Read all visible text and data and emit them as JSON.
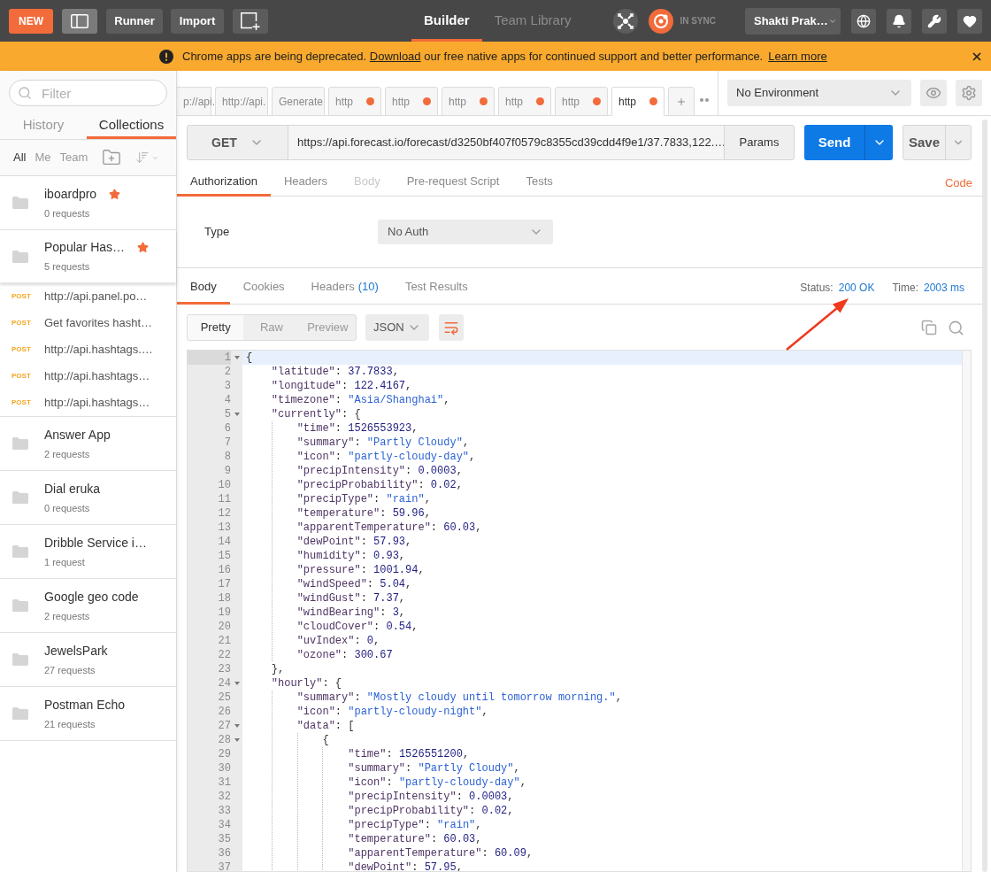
{
  "top_bar": {
    "new_button": "NEW",
    "runner_button": "Runner",
    "import_button": "Import",
    "nav_tabs": [
      {
        "label": "Builder",
        "selected": true
      },
      {
        "label": "Team Library",
        "selected": false
      }
    ],
    "sync_status": "IN SYNC",
    "user_menu": "Shakti Prak…"
  },
  "banner": {
    "message_start": "Chrome apps are being deprecated.",
    "message_link": "Download",
    "message_end": "our free native apps for continued support and better performance.",
    "learn_more_link": "Learn more"
  },
  "sidebar": {
    "filter_placeholder": "Filter",
    "tabs": [
      {
        "label": "History",
        "selected": false
      },
      {
        "label": "Collections",
        "selected": true
      }
    ],
    "owner_filters": [
      {
        "label": "All",
        "selected": true
      },
      {
        "label": "Me",
        "selected": false
      },
      {
        "label": "Team",
        "selected": false
      }
    ],
    "collections": [
      {
        "name": "iboardpro",
        "count": "0 requests",
        "starred": true,
        "expanded": false
      },
      {
        "name": "Popular Has…",
        "count": "5 requests",
        "starred": true,
        "expanded": true,
        "requests": [
          {
            "method": "POST",
            "name": "http://api.panel.po…"
          },
          {
            "method": "POST",
            "name": "Get favorites hasht…"
          },
          {
            "method": "POST",
            "name": "http://api.hashtags.…"
          },
          {
            "method": "POST",
            "name": "http://api.hashtags…"
          },
          {
            "method": "POST",
            "name": "http://api.hashtags…"
          }
        ]
      },
      {
        "name": "Answer App",
        "count": "2 requests",
        "starred": false,
        "expanded": false
      },
      {
        "name": "Dial eruka",
        "count": "0 requests",
        "starred": false,
        "expanded": false
      },
      {
        "name": "Dribble Service i…",
        "count": "1 request",
        "starred": false,
        "expanded": false
      },
      {
        "name": "Google geo code",
        "count": "2 requests",
        "starred": false,
        "expanded": false
      },
      {
        "name": "JewelsPark",
        "count": "27 requests",
        "starred": false,
        "expanded": false
      },
      {
        "name": "Postman Echo",
        "count": "21 requests",
        "starred": false,
        "expanded": false
      }
    ]
  },
  "request_tabs": [
    {
      "label": "p://api.",
      "unsaved": false,
      "selected": false
    },
    {
      "label": "http://api.",
      "unsaved": false,
      "selected": false
    },
    {
      "label": "Generate",
      "unsaved": false,
      "selected": false
    },
    {
      "label": "http",
      "unsaved": true,
      "selected": false
    },
    {
      "label": "http",
      "unsaved": true,
      "selected": false
    },
    {
      "label": "http",
      "unsaved": true,
      "selected": false
    },
    {
      "label": "http",
      "unsaved": true,
      "selected": false
    },
    {
      "label": "http",
      "unsaved": true,
      "selected": false
    },
    {
      "label": "http",
      "unsaved": true,
      "selected": true
    }
  ],
  "environment": "No Environment",
  "request": {
    "method": "GET",
    "url": "https://api.forecast.io/forecast/d3250bf407f0579c8355cd39cdd4f9e1/37.7833,122.…",
    "params_button": "Params",
    "send_button": "Send",
    "save_button": "Save"
  },
  "request_options": {
    "tabs": [
      {
        "label": "Authorization",
        "selected": true,
        "disabled": false
      },
      {
        "label": "Headers",
        "selected": false,
        "disabled": false
      },
      {
        "label": "Body",
        "selected": false,
        "disabled": true
      },
      {
        "label": "Pre-request Script",
        "selected": false,
        "disabled": false
      },
      {
        "label": "Tests",
        "selected": false,
        "disabled": false
      }
    ],
    "code_link": "Code"
  },
  "authorization": {
    "type_label": "Type",
    "type_value": "No Auth"
  },
  "response": {
    "tabs": [
      {
        "label": "Body",
        "selected": true
      },
      {
        "label": "Cookies",
        "selected": false
      },
      {
        "label": "Headers",
        "count": "(10)",
        "selected": false
      },
      {
        "label": "Test Results",
        "selected": false
      }
    ],
    "status_label": "Status:",
    "status_value": "200 OK",
    "time_label": "Time:",
    "time_value": "2003 ms",
    "view_modes": [
      {
        "label": "Pretty",
        "selected": true
      },
      {
        "label": "Raw",
        "selected": false
      },
      {
        "label": "Preview",
        "selected": false
      }
    ],
    "format": "JSON",
    "lines": [
      {
        "number": "1",
        "text": "{",
        "foldable": true,
        "active": true
      },
      {
        "number": "2",
        "text": "    \"latitude\": 37.7833,",
        "foldable": false,
        "active": false
      },
      {
        "number": "3",
        "text": "    \"longitude\": 122.4167,",
        "foldable": false,
        "active": false
      },
      {
        "number": "4",
        "text": "    \"timezone\": \"Asia/Shanghai\",",
        "foldable": false,
        "active": false
      },
      {
        "number": "5",
        "text": "    \"currently\": {",
        "foldable": true,
        "active": false
      },
      {
        "number": "6",
        "text": "        \"time\": 1526553923,",
        "foldable": false,
        "active": false
      },
      {
        "number": "7",
        "text": "        \"summary\": \"Partly Cloudy\",",
        "foldable": false,
        "active": false
      },
      {
        "number": "8",
        "text": "        \"icon\": \"partly-cloudy-day\",",
        "foldable": false,
        "active": false
      },
      {
        "number": "9",
        "text": "        \"precipIntensity\": 0.0003,",
        "foldable": false,
        "active": false
      },
      {
        "number": "10",
        "text": "        \"precipProbability\": 0.02,",
        "foldable": false,
        "active": false
      },
      {
        "number": "11",
        "text": "        \"precipType\": \"rain\",",
        "foldable": false,
        "active": false
      },
      {
        "number": "12",
        "text": "        \"temperature\": 59.96,",
        "foldable": false,
        "active": false
      },
      {
        "number": "13",
        "text": "        \"apparentTemperature\": 60.03,",
        "foldable": false,
        "active": false
      },
      {
        "number": "14",
        "text": "        \"dewPoint\": 57.93,",
        "foldable": false,
        "active": false
      },
      {
        "number": "15",
        "text": "        \"humidity\": 0.93,",
        "foldable": false,
        "active": false
      },
      {
        "number": "16",
        "text": "        \"pressure\": 1001.94,",
        "foldable": false,
        "active": false
      },
      {
        "number": "17",
        "text": "        \"windSpeed\": 5.04,",
        "foldable": false,
        "active": false
      },
      {
        "number": "18",
        "text": "        \"windGust\": 7.37,",
        "foldable": false,
        "active": false
      },
      {
        "number": "19",
        "text": "        \"windBearing\": 3,",
        "foldable": false,
        "active": false
      },
      {
        "number": "20",
        "text": "        \"cloudCover\": 0.54,",
        "foldable": false,
        "active": false
      },
      {
        "number": "21",
        "text": "        \"uvIndex\": 0,",
        "foldable": false,
        "active": false
      },
      {
        "number": "22",
        "text": "        \"ozone\": 300.67",
        "foldable": false,
        "active": false
      },
      {
        "number": "23",
        "text": "    },",
        "foldable": false,
        "active": false
      },
      {
        "number": "24",
        "text": "    \"hourly\": {",
        "foldable": true,
        "active": false
      },
      {
        "number": "25",
        "text": "        \"summary\": \"Mostly cloudy until tomorrow morning.\",",
        "foldable": false,
        "active": false
      },
      {
        "number": "26",
        "text": "        \"icon\": \"partly-cloudy-night\",",
        "foldable": false,
        "active": false
      },
      {
        "number": "27",
        "text": "        \"data\": [",
        "foldable": true,
        "active": false
      },
      {
        "number": "28",
        "text": "            {",
        "foldable": true,
        "active": false
      },
      {
        "number": "29",
        "text": "                \"time\": 1526551200,",
        "foldable": false,
        "active": false
      },
      {
        "number": "30",
        "text": "                \"summary\": \"Partly Cloudy\",",
        "foldable": false,
        "active": false
      },
      {
        "number": "31",
        "text": "                \"icon\": \"partly-cloudy-day\",",
        "foldable": false,
        "active": false
      },
      {
        "number": "32",
        "text": "                \"precipIntensity\": 0.0003,",
        "foldable": false,
        "active": false
      },
      {
        "number": "33",
        "text": "                \"precipProbability\": 0.02,",
        "foldable": false,
        "active": false
      },
      {
        "number": "34",
        "text": "                \"precipType\": \"rain\",",
        "foldable": false,
        "active": false
      },
      {
        "number": "35",
        "text": "                \"temperature\": 60.03,",
        "foldable": false,
        "active": false
      },
      {
        "number": "36",
        "text": "                \"apparentTemperature\": 60.09,",
        "foldable": false,
        "active": false
      },
      {
        "number": "37",
        "text": "                \"dewPoint\": 57.95,",
        "foldable": false,
        "active": false
      }
    ]
  }
}
